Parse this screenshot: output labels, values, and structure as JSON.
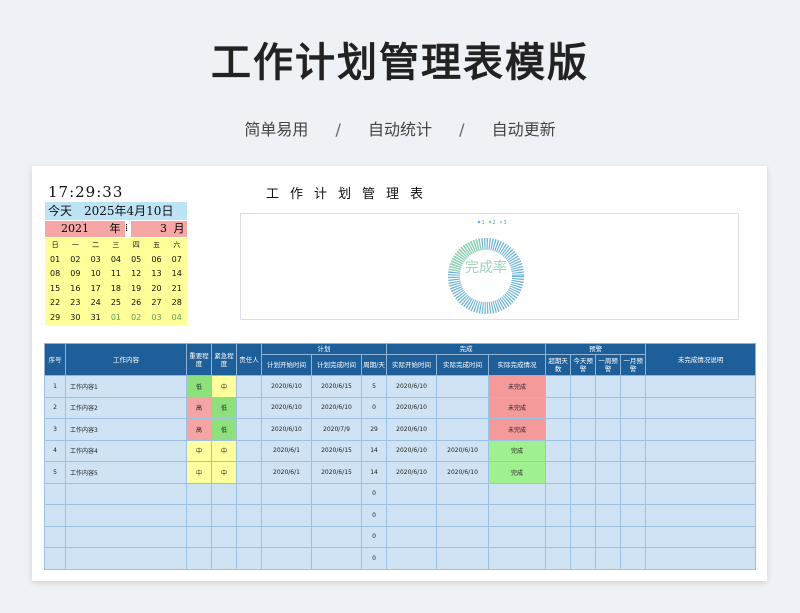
{
  "header": {
    "title": "工作计划管理表模版",
    "features": [
      "简单易用",
      "自动统计",
      "自动更新"
    ],
    "separator": "/"
  },
  "sheet": {
    "clock": "17:29:33",
    "title": "工作计划管理表"
  },
  "calendar": {
    "today_label": "今天　2025年4月10日",
    "year": "2021",
    "year_label": "年",
    "month": "3",
    "month_label": "月",
    "weekdays": [
      "日",
      "一",
      "二",
      "三",
      "四",
      "五",
      "六"
    ],
    "weeks": [
      [
        "01",
        "02",
        "03",
        "04",
        "05",
        "06",
        "07"
      ],
      [
        "08",
        "09",
        "10",
        "11",
        "12",
        "13",
        "14"
      ],
      [
        "15",
        "16",
        "17",
        "18",
        "19",
        "20",
        "21"
      ],
      [
        "22",
        "23",
        "24",
        "25",
        "26",
        "27",
        "28"
      ],
      [
        "29",
        "30",
        "31",
        "01",
        "02",
        "03",
        "04"
      ]
    ],
    "next_month_from_index": 3
  },
  "chart_data": {
    "type": "pie",
    "title": "完成率",
    "legend": [
      "1",
      "2",
      "3"
    ],
    "legend_position": "top",
    "colors": [
      "#6fb3d9",
      "#8fd5a8",
      "#a6d8f0"
    ]
  },
  "table": {
    "header_groups": {
      "plan": "计划",
      "done": "完成",
      "warning": "预警"
    },
    "columns": {
      "index": "序号",
      "content": "工作内容",
      "importance": "重要程度",
      "urgency": "紧急程度",
      "owner": "责任人",
      "plan_start": "计划开始时间",
      "plan_end": "计划完成时间",
      "period": "周期/天",
      "actual_start": "实际开始时间",
      "actual_end": "实际完成时间",
      "status": "实际完成情况",
      "overdue_days": "超期天数",
      "today_warn": "今天预警",
      "week_warn": "一周预警",
      "month_warn": "一月预警",
      "note": "未完成情况说明"
    },
    "rows": [
      {
        "index": "1",
        "content": "工作内容1",
        "importance": "低",
        "urgency": "中",
        "owner": "",
        "plan_start": "2020/6/10",
        "plan_end": "2020/6/15",
        "period": "5",
        "actual_start": "2020/6/10",
        "actual_end": "",
        "status": "未完成",
        "imp_level": "low",
        "urg_level": "mid",
        "state": "undone"
      },
      {
        "index": "2",
        "content": "工作内容2",
        "importance": "高",
        "urgency": "低",
        "owner": "",
        "plan_start": "2020/6/10",
        "plan_end": "2020/6/10",
        "period": "0",
        "actual_start": "2020/6/10",
        "actual_end": "",
        "status": "未完成",
        "imp_level": "high",
        "urg_level": "low",
        "state": "undone"
      },
      {
        "index": "3",
        "content": "工作内容3",
        "importance": "高",
        "urgency": "低",
        "owner": "",
        "plan_start": "2020/6/10",
        "plan_end": "2020/7/9",
        "period": "29",
        "actual_start": "2020/6/10",
        "actual_end": "",
        "status": "未完成",
        "imp_level": "high",
        "urg_level": "low",
        "state": "undone"
      },
      {
        "index": "4",
        "content": "工作内容4",
        "importance": "中",
        "urgency": "中",
        "owner": "",
        "plan_start": "2020/6/1",
        "plan_end": "2020/6/15",
        "period": "14",
        "actual_start": "2020/6/10",
        "actual_end": "2020/6/10",
        "status": "完成",
        "imp_level": "mid",
        "urg_level": "mid",
        "state": "done"
      },
      {
        "index": "5",
        "content": "工作内容5",
        "importance": "中",
        "urgency": "中",
        "owner": "",
        "plan_start": "2020/6/1",
        "plan_end": "2020/6/15",
        "period": "14",
        "actual_start": "2020/6/10",
        "actual_end": "2020/6/10",
        "status": "完成",
        "imp_level": "mid",
        "urg_level": "mid",
        "state": "done"
      }
    ],
    "empty_rows_period": [
      "0",
      "0",
      "0",
      "0"
    ]
  }
}
